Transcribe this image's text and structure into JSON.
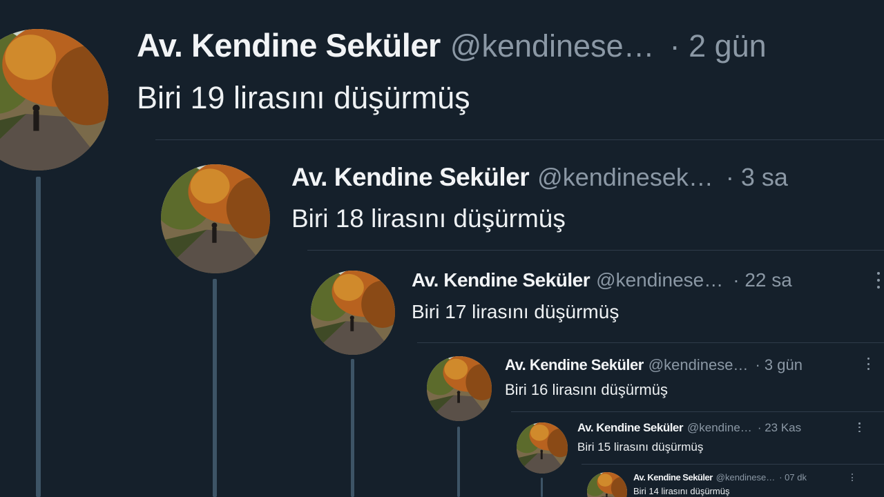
{
  "tweets": [
    {
      "name": "Av. Kendine Seküler",
      "handle": "@kendinese…",
      "time": "· 2 gün",
      "text": "Biri 19 lirasını düşürmüş"
    },
    {
      "name": "Av. Kendine Seküler",
      "handle": "@kendinesek…",
      "time": "· 3 sa",
      "text": "Biri 18 lirasını düşürmüş"
    },
    {
      "name": "Av. Kendine Seküler",
      "handle": "@kendinese…",
      "time": "· 22 sa",
      "text": "Biri 17 lirasını düşürmüş"
    },
    {
      "name": "Av. Kendine Seküler",
      "handle": "@kendinese…",
      "time": "· 3 gün",
      "text": "Biri 16 lirasını düşürmüş"
    },
    {
      "name": "Av. Kendine Seküler",
      "handle": "@kendine…",
      "time": "· 23 Kas",
      "text": "Biri 15 lirasını düşürmüş"
    },
    {
      "name": "Av. Kendine Seküler",
      "handle": "@kendinese…",
      "time": "· 07 dk",
      "text": "Biri 14 lirasını düşürmüş"
    }
  ],
  "colors": {
    "background": "#15202b",
    "name": "#f2f4f6",
    "secondary": "#8b98a5",
    "thread_line": "#3d5466"
  },
  "icons": {
    "avatar": "autumn-road-avatar",
    "more": "more-options-icon"
  }
}
